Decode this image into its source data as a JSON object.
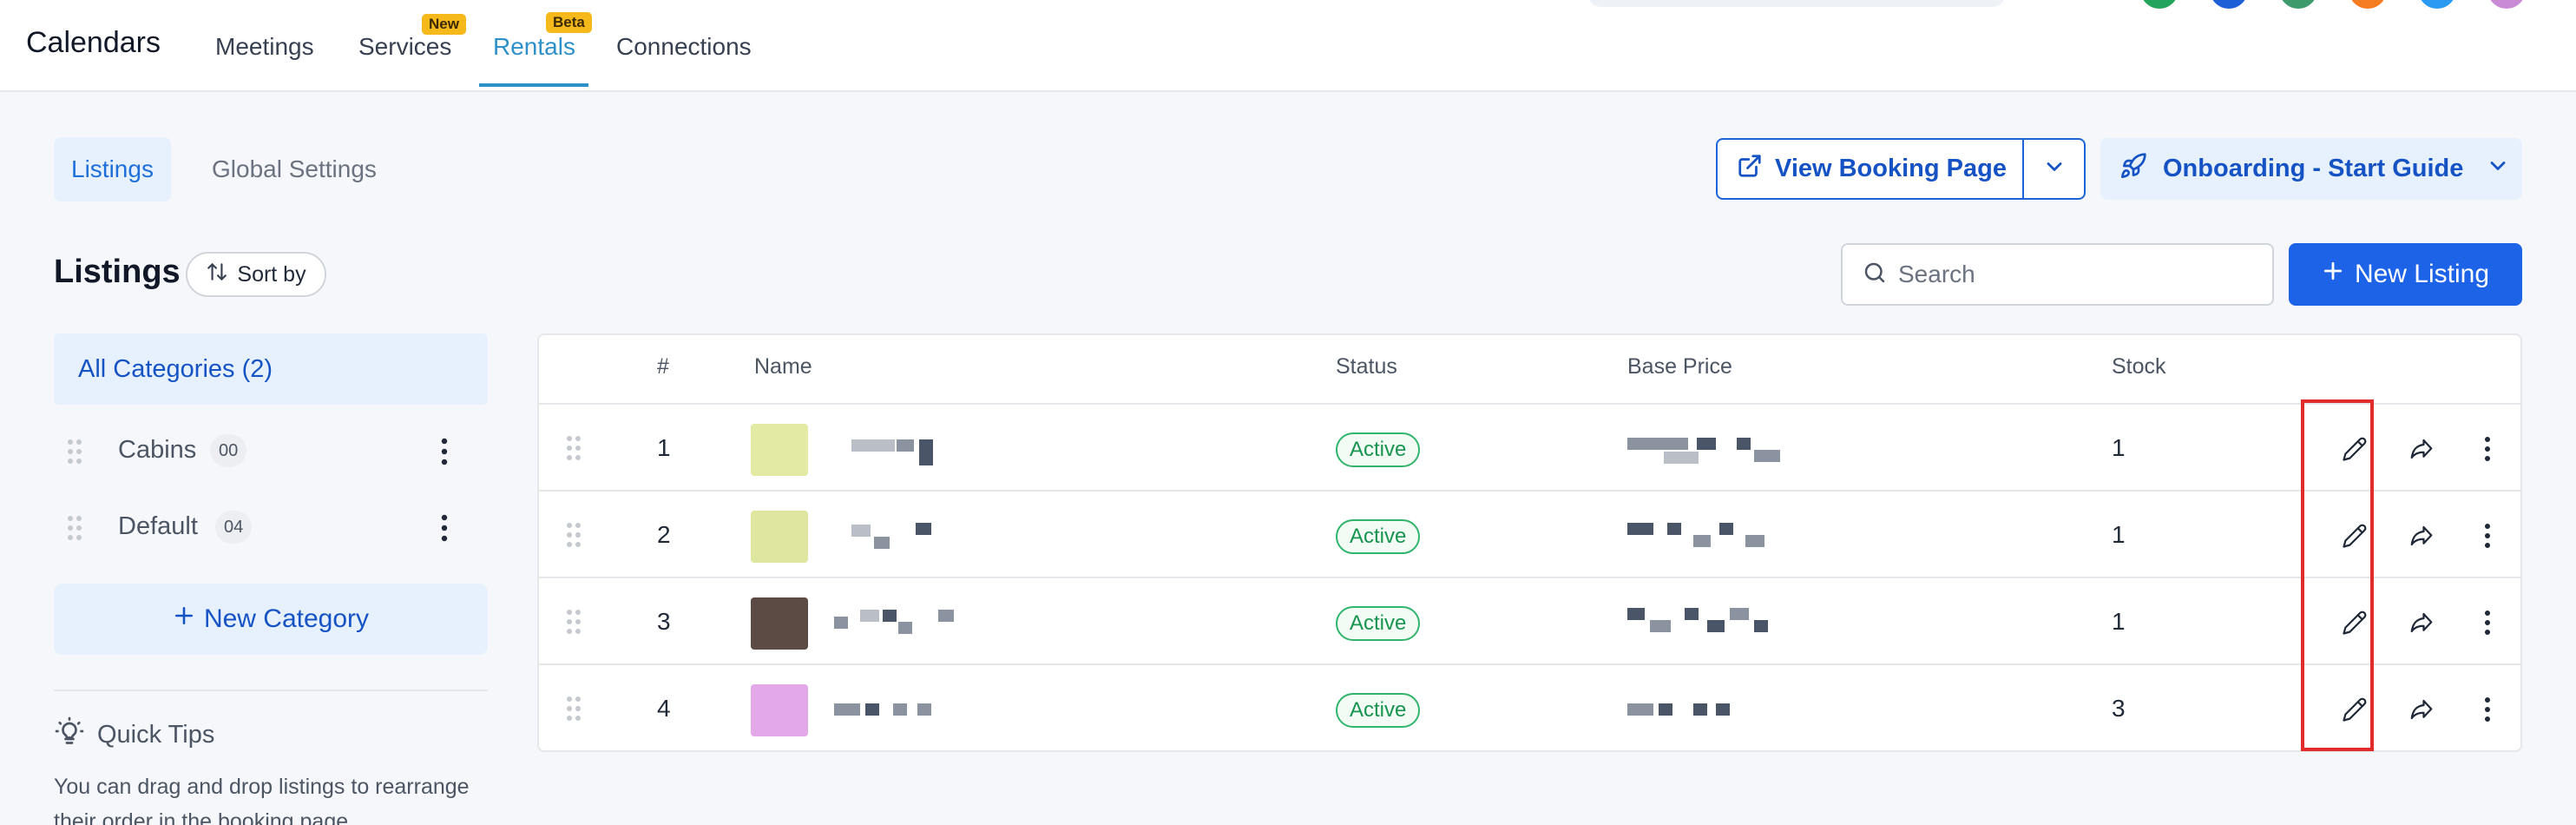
{
  "header": {
    "brand": "Calendars",
    "tabs": [
      {
        "label": "Meetings"
      },
      {
        "label": "Services",
        "badge": "New"
      },
      {
        "label": "Rentals",
        "badge": "Beta",
        "active": true
      },
      {
        "label": "Connections"
      }
    ],
    "avatar_colors": [
      "#22a45d",
      "#1d5fd6",
      "#3d9a6b",
      "#f57c22",
      "#2b9af3",
      "#c98ad6"
    ]
  },
  "subtabs": [
    {
      "label": "Listings",
      "active": true
    },
    {
      "label": "Global Settings"
    }
  ],
  "actions": {
    "view_booking_page": "View Booking Page",
    "onboarding": "Onboarding - Start Guide",
    "new_listing": "New Listing"
  },
  "listings": {
    "title": "Listings",
    "sort_label": "Sort by",
    "search_placeholder": "Search"
  },
  "categories": {
    "all_label": "All Categories (2)",
    "items": [
      {
        "label": "Cabins",
        "count": "00"
      },
      {
        "label": "Default",
        "count": "04"
      }
    ],
    "new_category": "New Category"
  },
  "quick_tips": {
    "title": "Quick Tips",
    "text": "You can drag and drop listings to rearrange their order in the booking page."
  },
  "table": {
    "columns": [
      "#",
      "Name",
      "Status",
      "Base Price",
      "Stock"
    ],
    "rows": [
      {
        "num": "1",
        "status": "Active",
        "stock": "1",
        "thumb_color": "#e3eaa4"
      },
      {
        "num": "2",
        "status": "Active",
        "stock": "1",
        "thumb_color": "#dfe6a0"
      },
      {
        "num": "3",
        "status": "Active",
        "stock": "1",
        "thumb_color": "#5c4a45"
      },
      {
        "num": "4",
        "status": "Active",
        "stock": "3",
        "thumb_color": "#e3a8e8"
      }
    ]
  },
  "colors": {
    "accent": "#1d63e8",
    "rentals_tab": "#2e90c8",
    "status_green": "#31b46b",
    "highlight": "#e22b2b",
    "badge_yellow": "#f6b91b"
  }
}
